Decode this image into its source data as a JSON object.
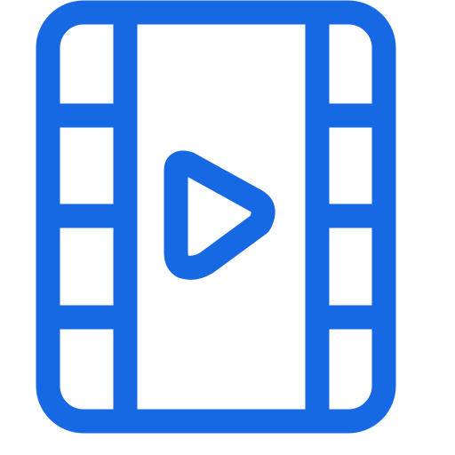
{
  "icon": {
    "name": "video-file-icon",
    "color": "#1668e3",
    "background": "#ffffff",
    "film_frames_per_side": 4
  }
}
